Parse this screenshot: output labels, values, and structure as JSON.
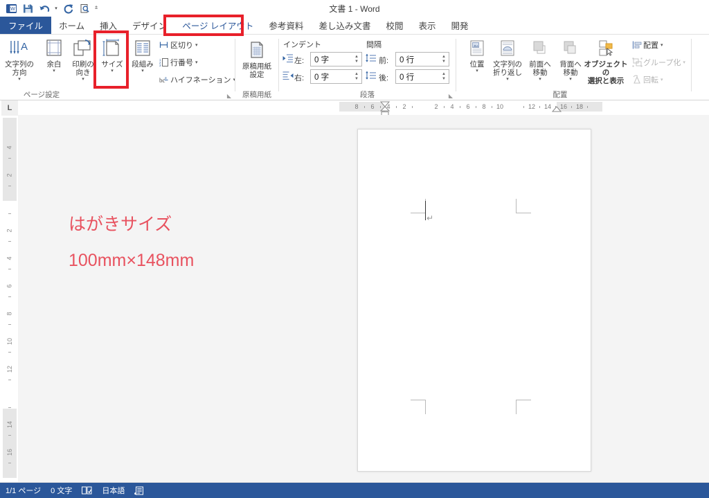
{
  "window": {
    "title": "文書 1 - Word"
  },
  "quick_access": {
    "items": [
      {
        "name": "word-logo-icon",
        "label": "W"
      },
      {
        "name": "save-icon",
        "label": "保存"
      },
      {
        "name": "undo-icon",
        "label": "元に戻す"
      },
      {
        "name": "redo-icon",
        "label": "やり直し"
      },
      {
        "name": "print-preview-icon",
        "label": "印刷プレビューと印刷"
      },
      {
        "name": "customize-qat-icon",
        "label": "クイック アクセス ツール バーのユーザー設定"
      }
    ]
  },
  "tabs": {
    "file_label": "ファイル",
    "items": [
      {
        "label": "ホーム",
        "active": false
      },
      {
        "label": "挿入",
        "active": false
      },
      {
        "label": "デザイン",
        "active": false
      },
      {
        "label": "ページ レイアウト",
        "active": true
      },
      {
        "label": "参考資料",
        "active": false
      },
      {
        "label": "差し込み文書",
        "active": false
      },
      {
        "label": "校閲",
        "active": false
      },
      {
        "label": "表示",
        "active": false
      },
      {
        "label": "開発",
        "active": false
      }
    ]
  },
  "ribbon": {
    "groups": [
      {
        "name": "page-setup",
        "label": "ページ設定",
        "has_dialog_launcher": true,
        "big_buttons": [
          {
            "name": "text-direction-button",
            "label": "文字列の\n方向",
            "caret": "▾"
          },
          {
            "name": "margins-button",
            "label": "余白",
            "caret": "▾"
          },
          {
            "name": "orientation-button",
            "label": "印刷の\n向き",
            "caret": "▾"
          },
          {
            "name": "size-button",
            "label": "サイズ",
            "caret": "▾",
            "highlighted": true
          },
          {
            "name": "columns-button",
            "label": "段組み",
            "caret": "▾"
          }
        ],
        "small_buttons": [
          {
            "name": "breaks-button",
            "label": "区切り",
            "caret": "▾"
          },
          {
            "name": "line-numbers-button",
            "label": "行番号",
            "caret": "▾"
          },
          {
            "name": "hyphenation-button",
            "label": "ハイフネーション",
            "caret": "▾"
          }
        ]
      },
      {
        "name": "manuscript-paper",
        "label": "原稿用紙",
        "has_dialog_launcher": false,
        "big_buttons": [
          {
            "name": "manuscript-settings-button",
            "label": "原稿用紙\n設定",
            "caret": ""
          }
        ]
      },
      {
        "name": "paragraph",
        "label": "段落",
        "has_dialog_launcher": true,
        "sections": [
          {
            "name": "indent-section",
            "heading": "インデント",
            "fields": [
              {
                "name": "indent-left-field",
                "label": "左:",
                "value": "0 字"
              },
              {
                "name": "indent-right-field",
                "label": "右:",
                "value": "0 字"
              }
            ]
          },
          {
            "name": "spacing-section",
            "heading": "間隔",
            "fields": [
              {
                "name": "spacing-before-field",
                "label": "前:",
                "value": "0 行"
              },
              {
                "name": "spacing-after-field",
                "label": "後:",
                "value": "0 行"
              }
            ]
          }
        ]
      },
      {
        "name": "arrange",
        "label": "配置",
        "has_dialog_launcher": false,
        "big_buttons": [
          {
            "name": "position-button",
            "label": "位置",
            "caret": "▾"
          },
          {
            "name": "wrap-text-button",
            "label": "文字列の\n折り返し",
            "caret": "▾"
          },
          {
            "name": "bring-forward-button",
            "label": "前面へ\n移動",
            "caret": "▾"
          },
          {
            "name": "send-backward-button",
            "label": "背面へ\n移動",
            "caret": "▾"
          },
          {
            "name": "selection-pane-button",
            "label": "オブジェクトの\n選択と表示",
            "caret": ""
          }
        ],
        "small_buttons": [
          {
            "name": "align-button",
            "label": "配置",
            "caret": "▾",
            "disabled": false
          },
          {
            "name": "group-button",
            "label": "グループ化",
            "caret": "▾",
            "disabled": true
          },
          {
            "name": "rotate-button",
            "label": "回転",
            "caret": "▾",
            "disabled": true
          }
        ]
      }
    ]
  },
  "rulers": {
    "tab_selector_glyph": "L",
    "horizontal_numbers": [
      "8",
      "6",
      "4",
      "2",
      "2",
      "4",
      "6",
      "8",
      "10",
      "12",
      "14",
      "16",
      "18"
    ],
    "vertical_numbers": [
      "4",
      "2",
      "2",
      "4",
      "6",
      "8",
      "10",
      "12",
      "14",
      "16"
    ]
  },
  "document": {
    "paragraph_mark": "↵",
    "annotation_line1": "はがきサイズ",
    "annotation_line2": "100mm×148mm"
  },
  "status_bar": {
    "page_label": "1/1 ページ",
    "word_count_label": "0 文字",
    "proofing_icon_name": "proofing-errors-icon",
    "language_label": "日本語",
    "macro_icon_name": "macro-recording-icon"
  },
  "colors": {
    "accent": "#2b579a",
    "highlight": "#e8202a",
    "annotation": "#e8525f"
  }
}
